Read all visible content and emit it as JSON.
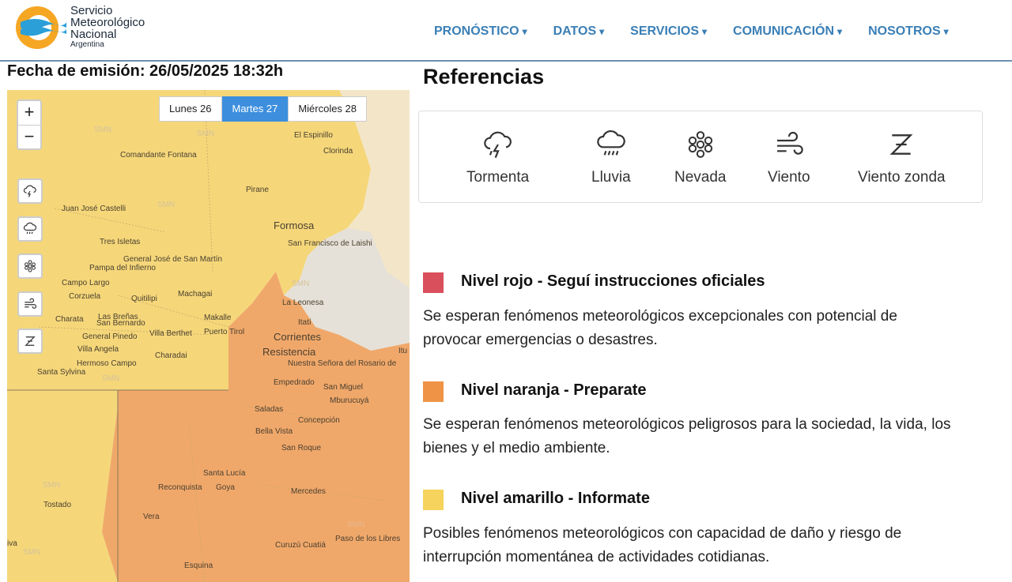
{
  "header": {
    "logo_line1": "Servicio",
    "logo_line2": "Meteorológico",
    "logo_line3": "Nacional",
    "logo_line4": "Argentina",
    "nav": [
      "PRONÓSTICO",
      "DATOS",
      "SERVICIOS",
      "COMUNICACIÓN",
      "NOSOTROS"
    ],
    "nav_caret": "▾"
  },
  "fecha": "Fecha de emisión: 26/05/2025 18:32h",
  "map": {
    "zoom_in": "+",
    "zoom_out": "−",
    "days": [
      "Lunes 26",
      "Martes 27",
      "Miércoles 28"
    ],
    "active_day": "Martes 27",
    "watermark": "SMN",
    "places": [
      "El Espinillo",
      "Clorinda",
      "Comandante Fontana",
      "Pirane",
      "Juan José Castelli",
      "Formosa",
      "San Francisco de Laishi",
      "Tres Isletas",
      "General José de San Martín",
      "Pampa del Infierno",
      "Campo Largo",
      "Corzuela",
      "Quitilipi",
      "Machagai",
      "La Leonesa",
      "Charata",
      "Las Breñas",
      "San Bernardo",
      "Makalle",
      "Itatí",
      "General Pinedo",
      "Villa Berthet",
      "Puerto Tirol",
      "Corrientes",
      "Villa Angela",
      "Resistencia",
      "Hermoso Campo",
      "Charadai",
      "Nuestra Señora del Rosario de",
      "Santa Sylvina",
      "Empedrado",
      "San Miguel",
      "Mburucuyá",
      "Saladas",
      "Concepción",
      "Bella Vista",
      "San Roque",
      "Santa Lucía",
      "Reconquista",
      "Goya",
      "Mercedes",
      "Tostado",
      "Vera",
      "Paso de los Libres",
      "Curuzú Cuatiá",
      "Esquina",
      "iva",
      "Itu"
    ],
    "colors": {
      "yellow": "#f5d77a",
      "orange": "#f0a86a",
      "land": "#f3e6c8",
      "river": "#e8e4dc"
    }
  },
  "references": {
    "title": "Referencias",
    "items": [
      {
        "label": "Tormenta",
        "icon": "storm-icon"
      },
      {
        "label": "Lluvia",
        "icon": "rain-icon"
      },
      {
        "label": "Nevada",
        "icon": "snow-icon"
      },
      {
        "label": "Viento",
        "icon": "wind-icon"
      },
      {
        "label": "Viento zonda",
        "icon": "zonda-icon"
      }
    ]
  },
  "levels": [
    {
      "title": "Nivel rojo - Seguí instrucciones oficiales",
      "color": "#d94f5c",
      "desc": "Se esperan fenómenos meteorológicos excepcionales con potencial de provocar emergencias o desastres."
    },
    {
      "title": "Nivel naranja - Preparate",
      "color": "#ef9447",
      "desc": "Se esperan fenómenos meteorológicos peligrosos para la sociedad, la vida, los bienes y el medio ambiente."
    },
    {
      "title": "Nivel amarillo - Informate",
      "color": "#f5d35c",
      "desc": "Posibles fenómenos meteorológicos con capacidad de daño y riesgo de interrupción momentánea de actividades cotidianas."
    }
  ]
}
